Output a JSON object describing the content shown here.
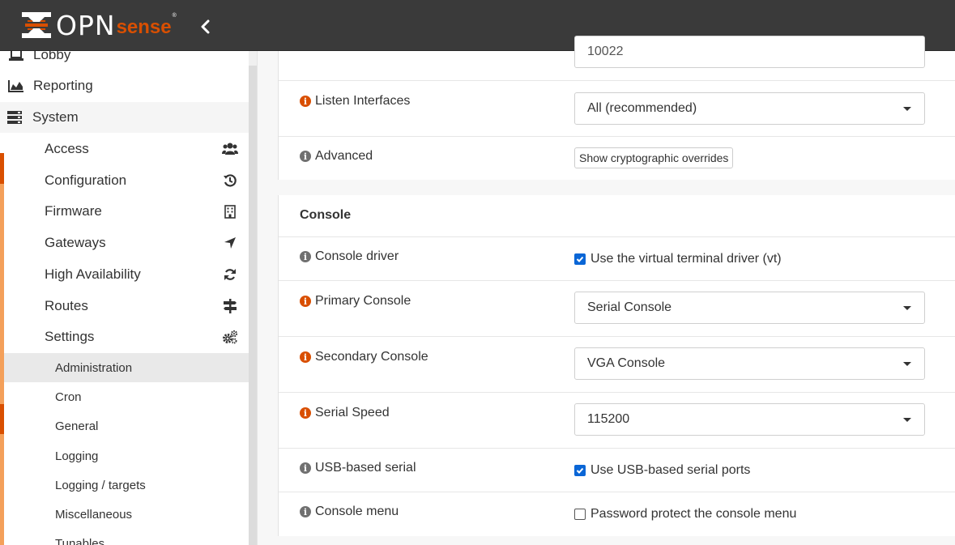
{
  "brand": {
    "name_main": "OPN",
    "name_sub": "sense",
    "registered": "®",
    "accent_color": "#d94f00"
  },
  "sidebar": {
    "top_items": [
      {
        "label": "Lobby",
        "icon": "laptop-icon"
      },
      {
        "label": "Reporting",
        "icon": "area-chart-icon"
      },
      {
        "label": "System",
        "icon": "server-icon"
      }
    ],
    "system_items": [
      {
        "label": "Access",
        "icon": "users-icon"
      },
      {
        "label": "Configuration",
        "icon": "history-icon"
      },
      {
        "label": "Firmware",
        "icon": "building-icon"
      },
      {
        "label": "Gateways",
        "icon": "location-arrow-icon"
      },
      {
        "label": "High Availability",
        "icon": "refresh-icon"
      },
      {
        "label": "Routes",
        "icon": "map-signs-icon"
      },
      {
        "label": "Settings",
        "icon": "cogs-icon"
      }
    ],
    "settings_items": [
      {
        "label": "Administration",
        "active": true
      },
      {
        "label": "Cron"
      },
      {
        "label": "General"
      },
      {
        "label": "Logging"
      },
      {
        "label": "Logging / targets"
      },
      {
        "label": "Miscellaneous"
      },
      {
        "label": "Tunables"
      }
    ]
  },
  "ssh": {
    "port_value": "10022",
    "listen_label": "Listen Interfaces",
    "listen_value": "All (recommended)",
    "advanced_label": "Advanced",
    "advanced_button": "Show cryptographic overrides"
  },
  "console": {
    "title": "Console",
    "driver_label": "Console driver",
    "driver_check": "Use the virtual terminal driver (vt)",
    "driver_checked": true,
    "primary_label": "Primary Console",
    "primary_value": "Serial Console",
    "secondary_label": "Secondary Console",
    "secondary_value": "VGA Console",
    "speed_label": "Serial Speed",
    "speed_value": "115200",
    "usb_label": "USB-based serial",
    "usb_check": "Use USB-based serial ports",
    "usb_checked": true,
    "menu_label": "Console menu",
    "menu_check": "Password protect the console menu",
    "menu_checked": false
  }
}
